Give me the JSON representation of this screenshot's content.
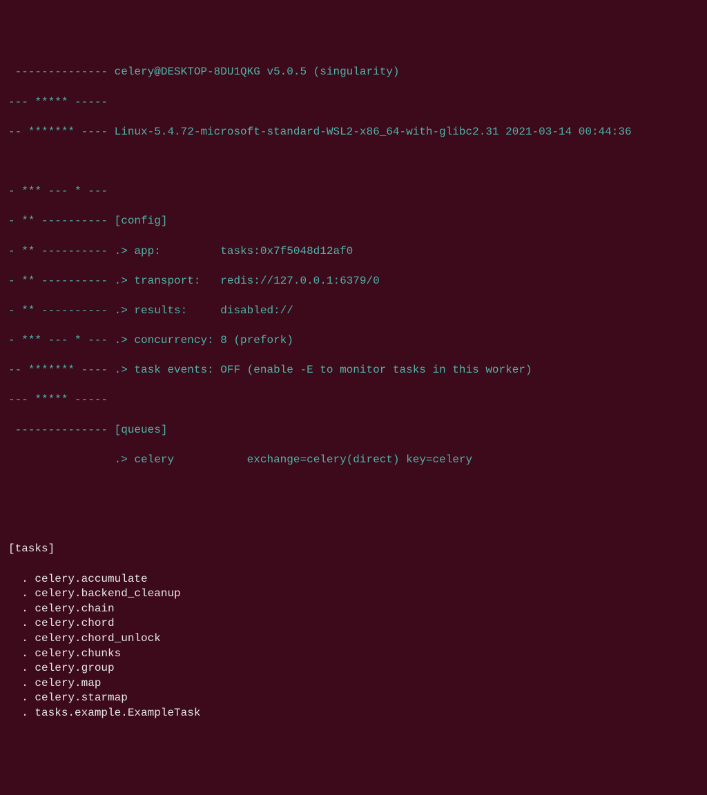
{
  "banner": {
    "line1_left": " -------------- ",
    "line1_right": "celery@DESKTOP-8DU1QKG v5.0.5 (singularity)",
    "line2": "--- ***** -----",
    "line3_left": "-- ******* ---- ",
    "line3_right": "Linux-5.4.72-microsoft-standard-WSL2-x86_64-with-glibc2.31 2021-03-14 00:44:36"
  },
  "config": {
    "l1": "- *** --- * ---",
    "l2_left": "- ** ---------- ",
    "l2_right": "[config]",
    "app_left": "- ** ---------- .> app:         ",
    "app_value": "tasks:0x7f5048d12af0",
    "transport_left": "- ** ---------- .> transport:   ",
    "transport_value": "redis://127.0.0.1:6379/0",
    "results_left": "- ** ---------- .> results:     ",
    "results_value": "disabled://",
    "concurrency_left": "- *** --- * --- .> concurrency: ",
    "concurrency_value": "8 (prefork)",
    "events_left": "-- ******* ---- .> task events: ",
    "events_value": "OFF (enable -E to monitor tasks in this worker)",
    "l9": "--- ***** -----"
  },
  "queues": {
    "l1_left": " -------------- ",
    "l1_right": "[queues]",
    "l2_left": "                .> ",
    "l2_name": "celery           ",
    "l2_rest": "exchange=celery(direct) key=celery"
  },
  "tasks": {
    "header": "[tasks]",
    "list": [
      "celery.accumulate",
      "celery.backend_cleanup",
      "celery.chain",
      "celery.chord",
      "celery.chord_unlock",
      "celery.chunks",
      "celery.group",
      "celery.map",
      "celery.starmap",
      "tasks.example.ExampleTask"
    ],
    "bullet": "  . "
  }
}
